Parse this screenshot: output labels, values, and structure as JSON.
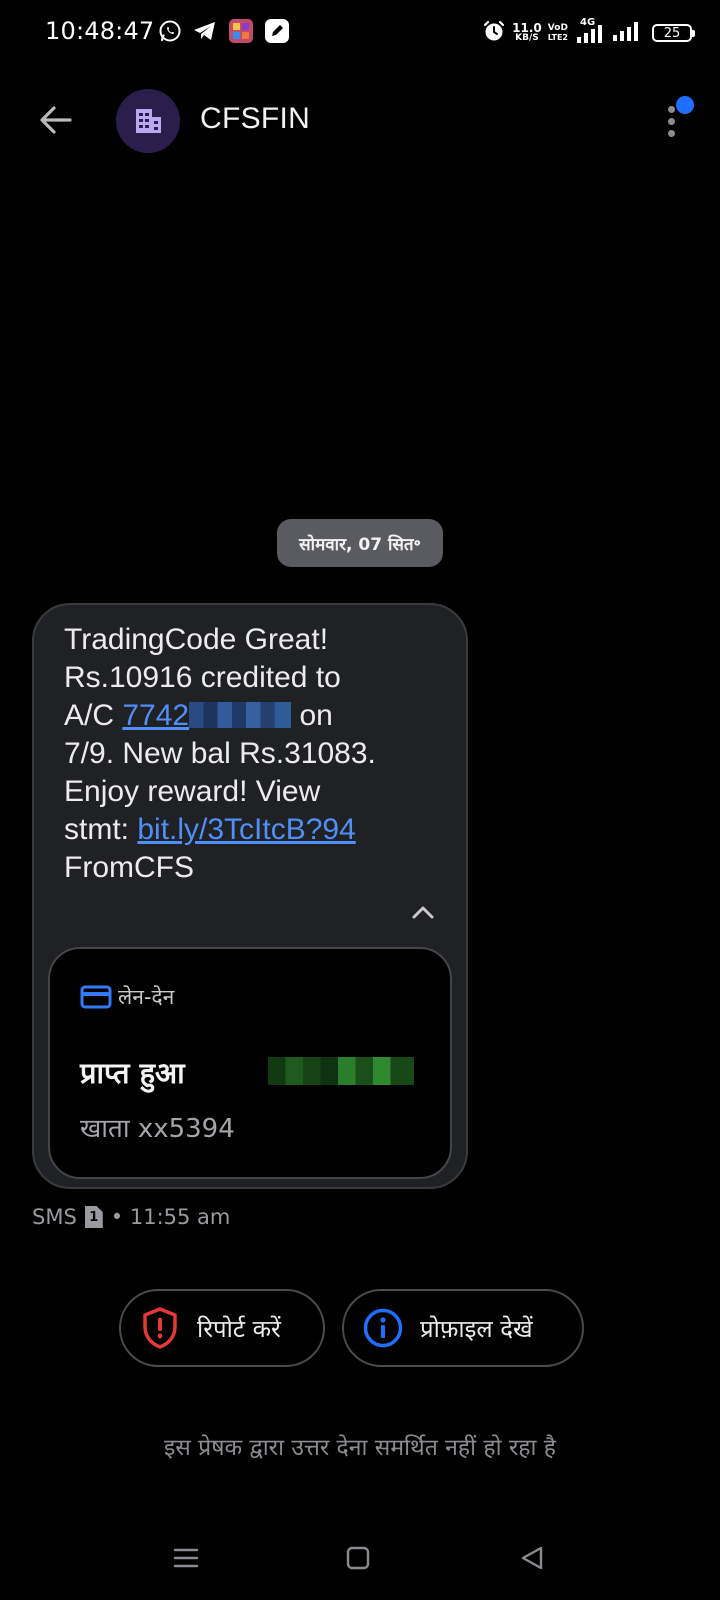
{
  "status_bar": {
    "time": "10:48:47",
    "net_speed_value": "11.0",
    "net_speed_unit": "KB/S",
    "volte_top": "VoD",
    "volte_bottom": "LTE2",
    "network_type": "4G",
    "battery": "25"
  },
  "header": {
    "contact_name": "CFSFIN"
  },
  "date_chip": "सोमवार, 07 सित॰",
  "message": {
    "line1": "TradingCode Great!",
    "line2": "Rs.10916 credited to",
    "line3_prefix": "A/C ",
    "account_link": "7742",
    "line3_suffix": " on",
    "line4": "7/9. New bal Rs.31083.",
    "line5": "Enjoy reward! View",
    "line6_prefix": "stmt: ",
    "stmt_link": "bit.ly/3TcItcB?94",
    "line7": "FromCFS"
  },
  "transaction_card": {
    "type_label": "लेन-देन",
    "status": "प्राप्त हुआ",
    "account": "खाता xx5394"
  },
  "meta": {
    "channel": "SMS",
    "sim": "1",
    "time": "• 11:55 am"
  },
  "actions": {
    "report_label": "रिपोर्ट करें",
    "profile_label": "प्रोफ़ाइल देखें"
  },
  "reply_note": "इस प्रेषक द्वारा उत्तर देना समर्थित नहीं हो रहा है",
  "colors": {
    "accent": "#4f8ff7",
    "report_red": "#e53935",
    "info_blue": "#1f6fff",
    "avatar_bg": "#2b1e4d"
  }
}
